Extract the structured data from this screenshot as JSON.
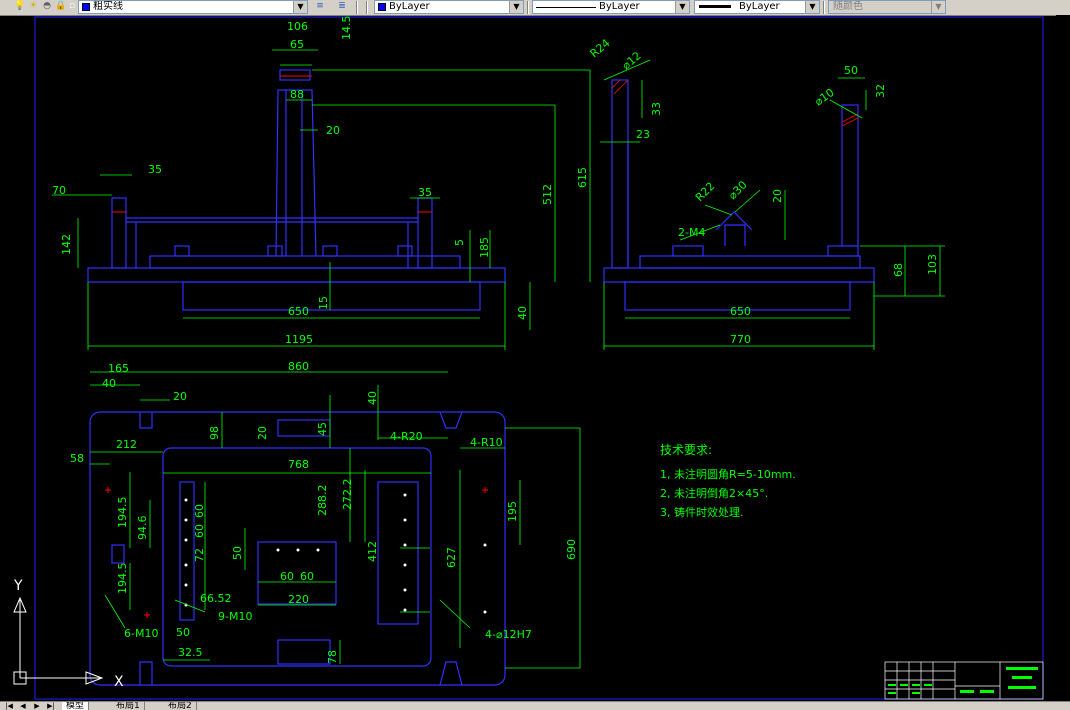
{
  "toolbar": {
    "linetype_name": "粗实线",
    "color_control": "ByLayer",
    "linetype_control": "ByLayer",
    "lineweight_control": "ByLayer",
    "plotstyle_control": "随颜色"
  },
  "drawing": {
    "front_view_dims": [
      "106",
      "65",
      "14.5",
      "88",
      "20",
      "35",
      "70",
      "142",
      "35",
      "5",
      "185",
      "512",
      "615",
      "15",
      "650",
      "40",
      "1195"
    ],
    "side_view_dims": [
      "R24",
      "⌀12",
      "33",
      "23",
      "50",
      "32",
      "⌀10",
      "R22",
      "⌀30",
      "20",
      "2-M4",
      "68",
      "103",
      "650",
      "770"
    ],
    "top_view_dims": [
      "165",
      "860",
      "40",
      "20",
      "40",
      "212",
      "98",
      "20",
      "45",
      "4-R20",
      "4-R10",
      "58",
      "768",
      "194.5",
      "94.6",
      "288.2",
      "272.2",
      "195",
      "60",
      "60",
      "72",
      "50",
      "412",
      "627",
      "690",
      "194.5",
      "60",
      "60",
      "66.52",
      "220",
      "9-M10",
      "6-M10",
      "50",
      "32.5",
      "78",
      "4-⌀12H7"
    ],
    "tech_requirements": {
      "title": "技术要求:",
      "items": [
        "1, 未注明圆角R=5-10mm.",
        "2, 未注明倒角2×45°.",
        "3, 铸件时效处理."
      ]
    },
    "ucs": {
      "x_label": "X",
      "y_label": "Y"
    }
  },
  "tabs": [
    "模型",
    "布局1",
    "布局2"
  ]
}
